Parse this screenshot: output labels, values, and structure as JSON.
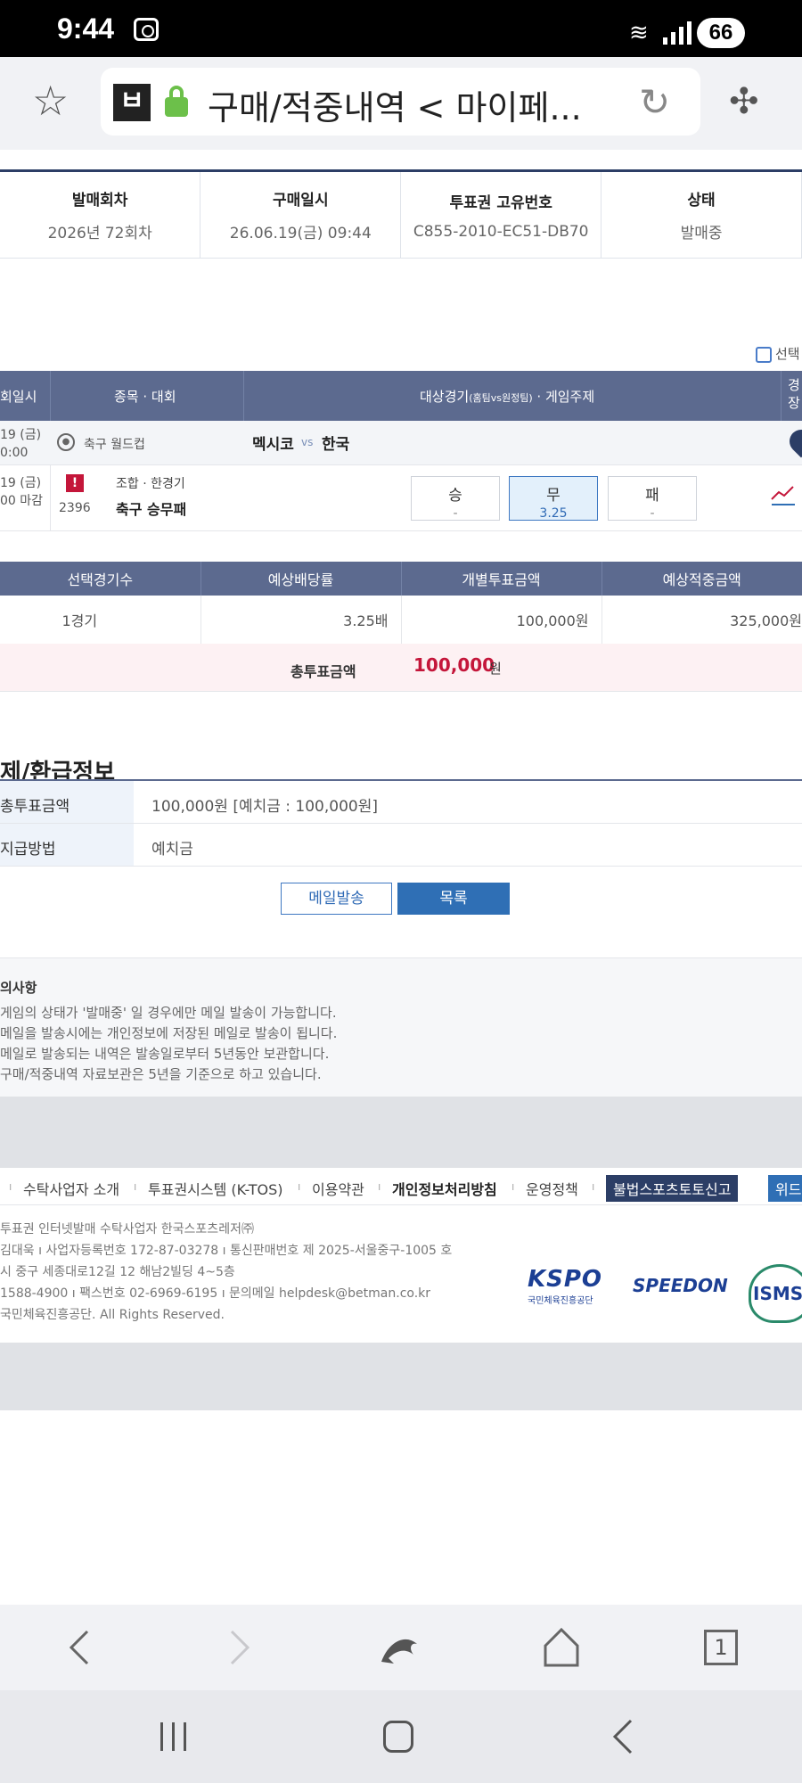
{
  "statusbar": {
    "time": "9:44",
    "battery": "66"
  },
  "browser": {
    "url_text": "구매/적중내역 < 마이페...",
    "tab_count": "1"
  },
  "info_table": {
    "headers": [
      "발매회차",
      "구매일시",
      "투표권 고유번호",
      "상태"
    ],
    "values": [
      "2026년 72회차",
      "26.06.19(금) 09:44",
      "C855-2010-EC51-DB70",
      "발매중"
    ]
  },
  "select_label": "선택",
  "game_header": {
    "col_time": "회일시",
    "col_event": "종목 · 대회",
    "col_match_main": "대상경기",
    "col_match_sub": "(홈팀vs원정팀)",
    "col_match_tail": " · 게임주제",
    "col_last": "경\n장"
  },
  "match_row": {
    "date_line1": "19 (금)",
    "date_line2": "0:00",
    "event": "축구 월드컵",
    "home": "멕시코",
    "vs": "vs",
    "away": "한국"
  },
  "game_row": {
    "date_line1": "19 (금)",
    "date_line2": "00 마감",
    "number": "2396",
    "type": "조합 · 한경기",
    "name": "축구 승무패",
    "options": [
      {
        "label": "승",
        "odds": "-",
        "selected": false
      },
      {
        "label": "무",
        "odds": "3.25",
        "selected": true
      },
      {
        "label": "패",
        "odds": "-",
        "selected": false
      }
    ]
  },
  "summary": {
    "headers": [
      "선택경기수",
      "예상배당률",
      "개별투표금액",
      "예상적중금액"
    ],
    "values": [
      "1경기",
      "3.25배",
      "100,000원",
      "325,000원"
    ],
    "total_label": "총투표금액",
    "total_amount": "100,000",
    "total_unit": "원"
  },
  "payment": {
    "title": "제/환급정보",
    "rows": [
      {
        "label": "총투표금액",
        "value": "100,000원 [예치금 : 100,000원]"
      },
      {
        "label": "지급방법",
        "value": "예치금"
      }
    ]
  },
  "buttons": {
    "mail": "메일발송",
    "list": "목록"
  },
  "notice": {
    "title": "의사항",
    "lines": [
      "게임의 상태가 '발매중' 일 경우에만 메일 발송이 가능합니다.",
      "메일을 발송시에는 개인정보에 저장된 메일로 발송이 됩니다.",
      "메일로 발송되는 내역은 발송일로부터 5년동안 보관합니다.",
      "구매/적중내역 자료보관은 5년을 기준으로 하고 있습니다."
    ]
  },
  "footer": {
    "links": [
      "수탁사업자 소개",
      "투표권시스템 (K-TOS)",
      "이용약관",
      "개인정보처리방침",
      "운영정책",
      "불법스포츠토토신고",
      "위드"
    ],
    "info_lines": [
      "투표권 인터넷발매 수탁사업자 한국스포츠레저㈜",
      "김대욱  ı  사업자등록번호 172-87-03278  ı  통신판매번호 제 2025-서울중구-1005 호",
      "시 중구 세종대로12길 12 해남2빌딩 4~5층",
      "1588-4900  ı  팩스번호 02-6969-6195  ı  문의메일 helpdesk@betman.co.kr",
      "국민체육진흥공단. All Rights Reserved."
    ],
    "logo_kspo": "KSPO",
    "logo_kspo_sub": "국민체육진흥공단",
    "logo_speedon": "SPEEDON",
    "logo_isms": "ISMS"
  }
}
